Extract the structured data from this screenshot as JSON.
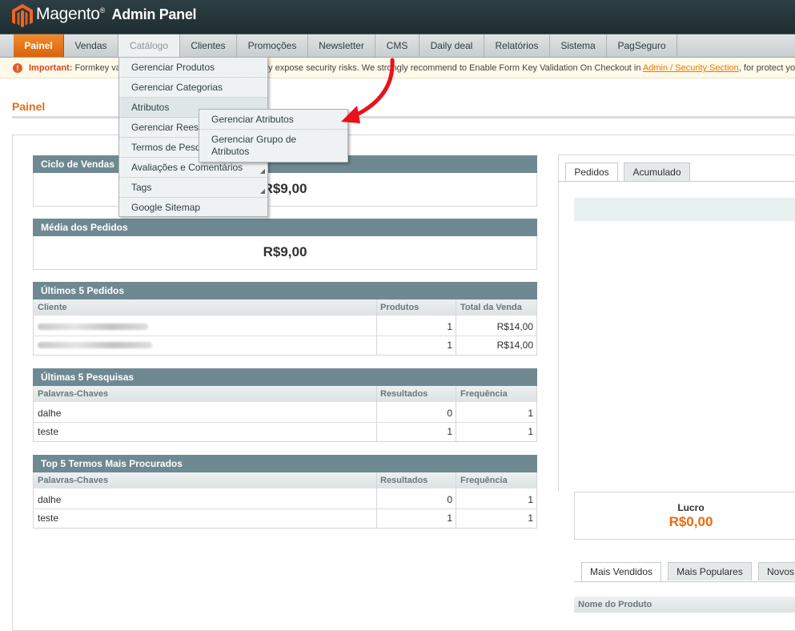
{
  "header": {
    "brand": "Magento",
    "trademark": "®",
    "subtitle": "Admin Panel"
  },
  "nav": {
    "items": [
      {
        "label": "Painel"
      },
      {
        "label": "Vendas"
      },
      {
        "label": "Catálogo"
      },
      {
        "label": "Clientes"
      },
      {
        "label": "Promoções"
      },
      {
        "label": "Newsletter"
      },
      {
        "label": "CMS"
      },
      {
        "label": "Daily deal"
      },
      {
        "label": "Relatórios"
      },
      {
        "label": "Sistema"
      },
      {
        "label": "PagSeguro"
      }
    ]
  },
  "notice": {
    "important": "Important:",
    "text_before": " Formkey va",
    "text_middle": "ay expose security risks. We strongly recommend to Enable Form Key Validation On Checkout in ",
    "link": "Admin / Security Section",
    "text_after": ", for protect yo"
  },
  "page": {
    "title": "Painel"
  },
  "catalog_menu": {
    "items": [
      {
        "label": "Gerenciar Produtos"
      },
      {
        "label": "Gerenciar Categorias"
      },
      {
        "label": "Atributos"
      },
      {
        "label": "Gerenciar Rees"
      },
      {
        "label": "Termos de Pesq"
      },
      {
        "label": "Avaliações e Comentários"
      },
      {
        "label": "Tags"
      },
      {
        "label": "Google Sitemap"
      }
    ],
    "submenu": [
      {
        "label": "Gerenciar Atributos"
      },
      {
        "label": "Gerenciar Grupo de Atributos"
      }
    ]
  },
  "sales_cycle": {
    "title": "Ciclo de Vendas",
    "value": "R$9,00"
  },
  "avg_orders": {
    "title": "Média dos Pedidos",
    "value": "R$9,00"
  },
  "last_orders": {
    "title": "Últimos 5 Pedidos",
    "columns": [
      "Cliente",
      "Produtos",
      "Total da Venda"
    ],
    "rows": [
      {
        "products": "1",
        "total": "R$14,00"
      },
      {
        "products": "1",
        "total": "R$14,00"
      }
    ]
  },
  "last_searches": {
    "title": "Últimas 5 Pesquisas",
    "columns": [
      "Palavras-Chaves",
      "Resultados",
      "Frequência"
    ],
    "rows": [
      {
        "keyword": "dalhe",
        "results": "0",
        "freq": "1"
      },
      {
        "keyword": "teste",
        "results": "1",
        "freq": "1"
      }
    ]
  },
  "top_searches": {
    "title": "Top 5 Termos Mais Procurados",
    "columns": [
      "Palavras-Chaves",
      "Resultados",
      "Frequência"
    ],
    "rows": [
      {
        "keyword": "dalhe",
        "results": "0",
        "freq": "1"
      },
      {
        "keyword": "teste",
        "results": "1",
        "freq": "1"
      }
    ]
  },
  "right_panel": {
    "tabs": [
      "Pedidos",
      "Acumulado"
    ],
    "profit_label": "Lucro",
    "profit_value": "R$0,00",
    "bottom_tabs": [
      "Mais Vendidos",
      "Mais Populares",
      "Novos"
    ],
    "product_column": "Nome do Produto"
  },
  "colors": {
    "accent": "#eb6b0c",
    "header_bg": "#2c3f45",
    "box_head": "#6f8992",
    "annotation_arrow": "#e8121b"
  }
}
